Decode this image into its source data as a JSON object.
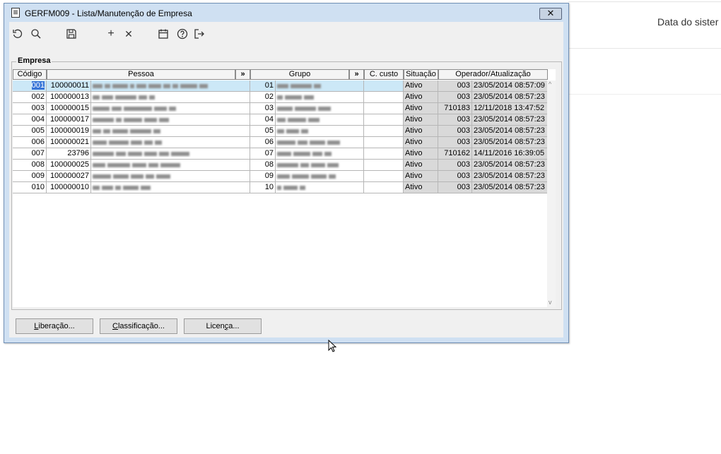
{
  "background": {
    "label": "Data do sister"
  },
  "window": {
    "title": "GERFM009 - Lista/Manutenção de Empresa",
    "close_glyph": "✕",
    "toolbar": {
      "icons": [
        "refresh-icon",
        "search-icon",
        "save-icon",
        "add-icon",
        "delete-icon",
        "calendar-icon",
        "help-icon",
        "exit-icon"
      ],
      "glyphs": {
        "add": "+",
        "delete": "✕"
      }
    },
    "group_title": "Empresa",
    "grid": {
      "columns": [
        "Código",
        "Pessoa",
        "»",
        "Grupo",
        "»",
        "C. custo",
        "Situação",
        "Operador/Atualização"
      ],
      "rows": [
        {
          "codigo": "001",
          "pessoa": "100000011",
          "grupo": "01",
          "c_custo": "",
          "situacao": "Ativo",
          "operador": "003",
          "atualizacao": "23/05/2014 08:57:09"
        },
        {
          "codigo": "002",
          "pessoa": "100000013",
          "grupo": "02",
          "c_custo": "",
          "situacao": "Ativo",
          "operador": "003",
          "atualizacao": "23/05/2014 08:57:23"
        },
        {
          "codigo": "003",
          "pessoa": "100000015",
          "grupo": "03",
          "c_custo": "",
          "situacao": "Ativo",
          "operador": "710183",
          "atualizacao": "12/11/2018 13:47:52"
        },
        {
          "codigo": "004",
          "pessoa": "100000017",
          "grupo": "04",
          "c_custo": "",
          "situacao": "Ativo",
          "operador": "003",
          "atualizacao": "23/05/2014 08:57:23"
        },
        {
          "codigo": "005",
          "pessoa": "100000019",
          "grupo": "05",
          "c_custo": "",
          "situacao": "Ativo",
          "operador": "003",
          "atualizacao": "23/05/2014 08:57:23"
        },
        {
          "codigo": "006",
          "pessoa": "100000021",
          "grupo": "06",
          "c_custo": "",
          "situacao": "Ativo",
          "operador": "003",
          "atualizacao": "23/05/2014 08:57:23"
        },
        {
          "codigo": "007",
          "pessoa": "23796",
          "grupo": "07",
          "c_custo": "",
          "situacao": "Ativo",
          "operador": "710162",
          "atualizacao": "14/11/2016 16:39:05"
        },
        {
          "codigo": "008",
          "pessoa": "100000025",
          "grupo": "08",
          "c_custo": "",
          "situacao": "Ativo",
          "operador": "003",
          "atualizacao": "23/05/2014 08:57:23"
        },
        {
          "codigo": "009",
          "pessoa": "100000027",
          "grupo": "09",
          "c_custo": "",
          "situacao": "Ativo",
          "operador": "003",
          "atualizacao": "23/05/2014 08:57:23"
        },
        {
          "codigo": "010",
          "pessoa": "100000010",
          "grupo": "10",
          "c_custo": "",
          "situacao": "Ativo",
          "operador": "003",
          "atualizacao": "23/05/2014 08:57:23"
        }
      ]
    },
    "buttons": {
      "liberacao": {
        "mnemonic": "L",
        "rest": "iberação..."
      },
      "classificacao": {
        "mnemonic": "C",
        "rest": "lassificação..."
      },
      "licenca": {
        "pre": "Licen",
        "mnemonic": "ç",
        "rest": "a..."
      }
    }
  }
}
